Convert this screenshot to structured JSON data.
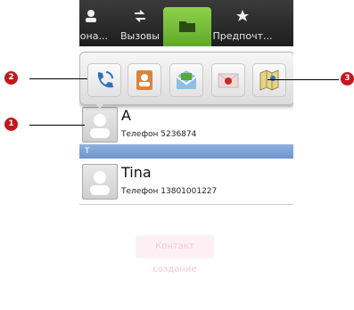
{
  "tabs": [
    {
      "label": "оона...",
      "icon": "contacts-icon"
    },
    {
      "label": "Вызовы",
      "icon": "calls-icon"
    },
    {
      "label": "",
      "icon": "groups-folder-icon",
      "selected": true
    },
    {
      "label": "Предпочт...",
      "icon": "star-icon"
    }
  ],
  "quick_contact": {
    "actions": [
      {
        "name": "call",
        "icon": "phone-icon"
      },
      {
        "name": "contact-card",
        "icon": "contact-card-icon"
      },
      {
        "name": "message",
        "icon": "message-icon"
      },
      {
        "name": "email",
        "icon": "email-icon"
      },
      {
        "name": "map",
        "icon": "map-icon"
      }
    ]
  },
  "contacts": [
    {
      "name": "A",
      "phone": "Телефон  5236874"
    },
    {
      "name": "Tina",
      "phone": "Телефон  13801001227"
    }
  ],
  "section_letter": "T",
  "ghost_button_label": "Контакт создание",
  "callouts": {
    "one": "1",
    "two": "2",
    "three": "3"
  },
  "colors": {
    "tab_selected": "#6fb833",
    "section_header": "#7aa0d8",
    "callout": "#c4161c"
  }
}
